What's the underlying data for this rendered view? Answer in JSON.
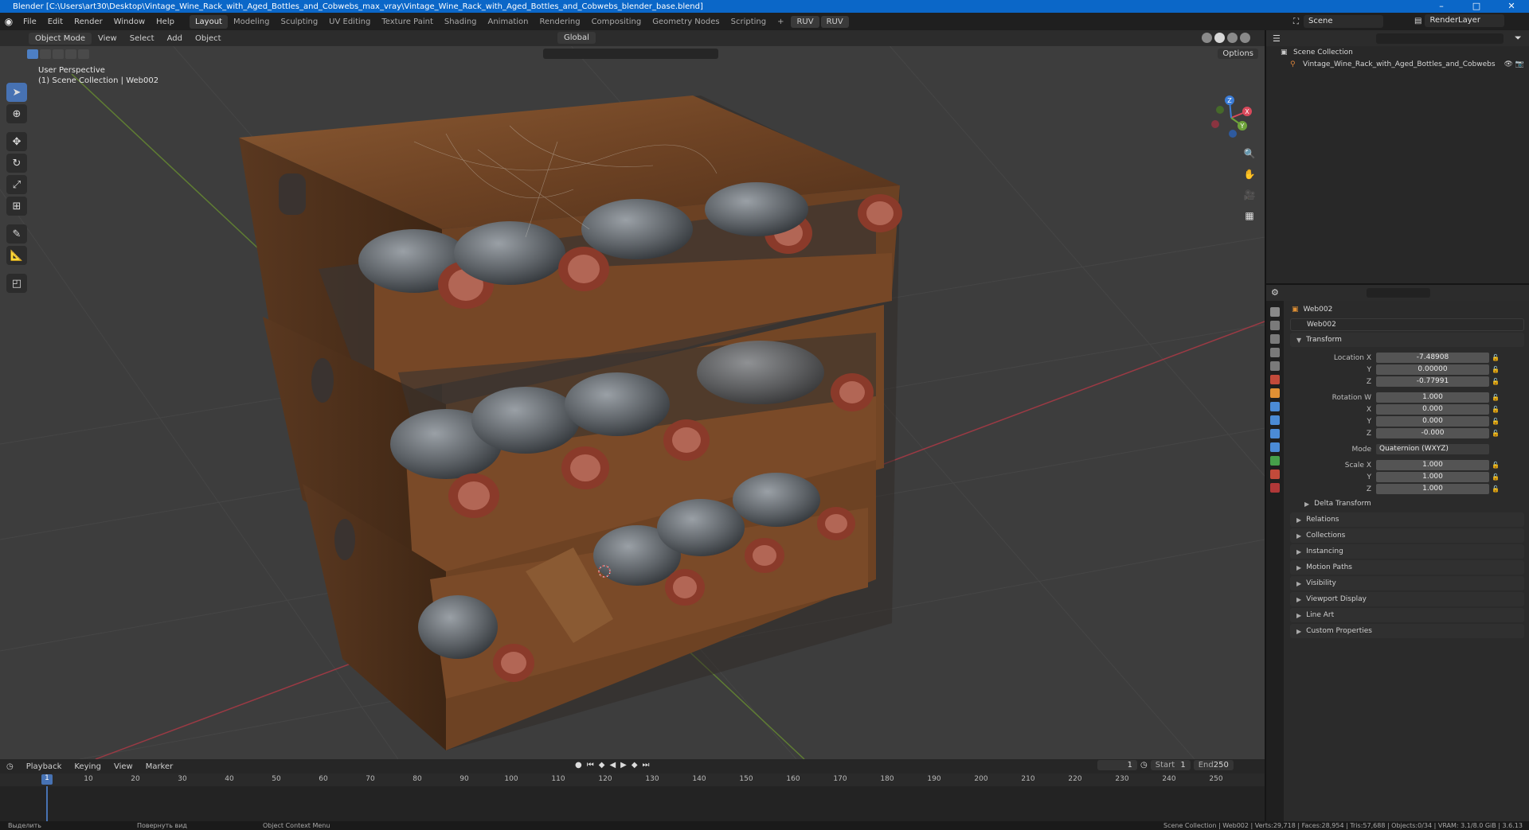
{
  "window": {
    "title": "Blender [C:\\Users\\art30\\Desktop\\Vintage_Wine_Rack_with_Aged_Bottles_and_Cobwebs_max_vray\\Vintage_Wine_Rack_with_Aged_Bottles_and_Cobwebs_blender_base.blend]",
    "controls": [
      "–",
      "□",
      "✕"
    ]
  },
  "menus": [
    "File",
    "Edit",
    "Render",
    "Window",
    "Help"
  ],
  "workspaces": [
    "Layout",
    "Modeling",
    "Sculpting",
    "UV Editing",
    "Texture Paint",
    "Shading",
    "Animation",
    "Rendering",
    "Compositing",
    "Geometry Nodes",
    "Scripting"
  ],
  "active_workspace": "Layout",
  "ruv_buttons": [
    "RUV",
    "RUV"
  ],
  "scene": {
    "name": "Scene",
    "render_layer": "RenderLayer"
  },
  "viewport": {
    "mode": "Object Mode",
    "header_menus": [
      "View",
      "Select",
      "Add",
      "Object"
    ],
    "orientation": "Global",
    "options_label": "Options",
    "info_line1": "User Perspective",
    "info_line2": "(1) Scene Collection | Web002"
  },
  "gizmo_axes": {
    "x": "X",
    "y": "Y",
    "z": "Z"
  },
  "timeline": {
    "menus": [
      "Playback",
      "Keying",
      "View",
      "Marker"
    ],
    "current_frame": "1",
    "start_label": "Start",
    "start": "1",
    "end_label": "End",
    "end": "250",
    "ticks": [
      "10",
      "20",
      "30",
      "40",
      "50",
      "60",
      "70",
      "80",
      "90",
      "100",
      "110",
      "120",
      "130",
      "140",
      "150",
      "160",
      "170",
      "180",
      "190",
      "200",
      "210",
      "220",
      "230",
      "240",
      "250"
    ],
    "cursor": "1"
  },
  "statusbar": {
    "left": "Выделить",
    "mid": "Повернуть вид",
    "ctx": "Object Context Menu",
    "right": "Scene Collection | Web002 | Verts:29,718 | Faces:28,954 | Tris:57,688 | Objects:0/34 | VRAM: 3.1/8.0 GiB | 3.6.13"
  },
  "outliner": {
    "collection": "Scene Collection",
    "item": "Vintage_Wine_Rack_with_Aged_Bottles_and_Cobwebs"
  },
  "properties": {
    "object_name": "Web002",
    "object_field": "Web002",
    "transform_title": "Transform",
    "location": {
      "label": "Location X",
      "x": "-7.48908",
      "y": "0.00000",
      "z": "-0.77991"
    },
    "rotation": {
      "label": "Rotation W",
      "w": "1.000",
      "x": "0.000",
      "y": "0.000",
      "z": "-0.000"
    },
    "mode": {
      "label": "Mode",
      "value": "Quaternion (WXYZ)"
    },
    "scale": {
      "label": "Scale X",
      "x": "1.000",
      "y": "1.000",
      "z": "1.000"
    },
    "axis_y": "Y",
    "axis_z": "Z",
    "axis_x": "X",
    "delta": "Delta Transform",
    "panels": [
      "Relations",
      "Collections",
      "Instancing",
      "Motion Paths",
      "Visibility",
      "Viewport Display",
      "Line Art",
      "Custom Properties"
    ]
  },
  "colors": {
    "accent": "#4772b3",
    "axis_red": "#d9495b",
    "axis_green": "#6ea33a",
    "axis_blue": "#3b7dd8",
    "wood": "#7a4a26",
    "bottle": "#6f7378",
    "cork": "#8a3a2a"
  }
}
